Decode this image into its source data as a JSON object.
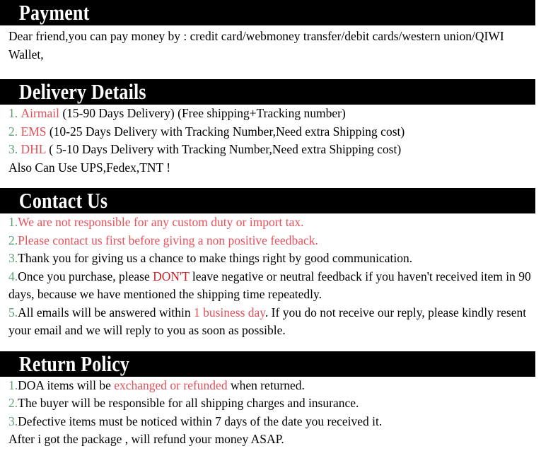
{
  "colors": {
    "bar_bg": "#000000",
    "bar_text": "#ffffff",
    "body_text": "#000000",
    "list_number_green": "#5f9e72",
    "red_soft": "#e0505a",
    "red_deep": "#cc2026"
  },
  "sections": {
    "payment": {
      "title": "Payment",
      "body_line_1": "Dear friend,you can pay money by : credit card/webmoney transfer/debit cards/western union/QIWI Wallet,"
    },
    "delivery": {
      "title": "Delivery Details",
      "items": [
        {
          "number": "1.",
          "name": "Airmail",
          "rest": " (15-90 Days Delivery) (Free shipping+Tracking number)"
        },
        {
          "number": "2.",
          "name": "EMS",
          "rest": " (10-25 Days Delivery with Tracking Number,Need extra Shipping cost)"
        },
        {
          "number": "3.",
          "name": "DHL",
          "rest": " ( 5-10 Days Delivery with Tracking Number,Need extra Shipping cost)"
        }
      ],
      "footer": "Also Can Use UPS,Fedex,TNT !"
    },
    "contact": {
      "title": "Contact Us",
      "item1_number": "1.",
      "item1_text": "We are not responsible for any custom duty or import tax.",
      "item2_number": "2.",
      "item2_text": "Please contact us first before giving a non positive feedback.",
      "item3_number": "3.",
      "item3_text": "Thank you for giving us a chance to make things right by good communication.",
      "item4_number": "4.",
      "item4_part1": "Once you purchase, please ",
      "item4_emph": "DON'T",
      "item4_part2": " leave negative or neutral feedback if you haven't received item in 90 days, because we have mentioned the shipping time repeatedly.",
      "item5_number": "5.",
      "item5_part1": "All emails will be answered within ",
      "item5_emph": "1 business day",
      "item5_part2": ". If you do not receive our reply, please kindly resent your email and we will reply to you as soon as possible."
    },
    "return_policy": {
      "title": "Return Policy",
      "item1_number": "1.",
      "item1_part1": "DOA items will be ",
      "item1_emph": "exchanged or refunded",
      "item1_part2": " when returned.",
      "item2_number": "2.",
      "item2_text": "The buyer will be responsible for all shipping charges and insurance.",
      "item3_number": "3.",
      "item3_text": "Defective items must be noticed within 7 days of the date you received it.",
      "footer": "After i got the package , will refund your money ASAP."
    }
  }
}
